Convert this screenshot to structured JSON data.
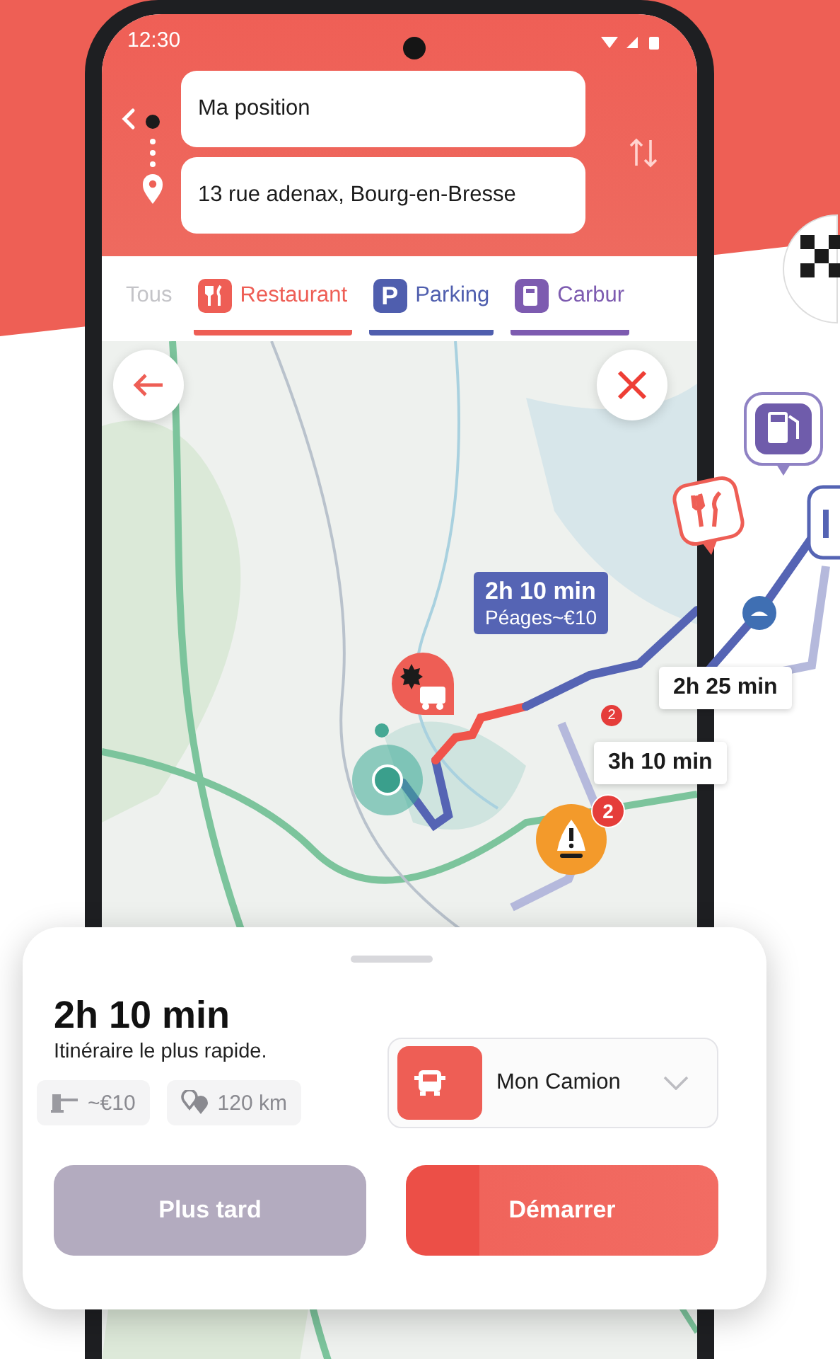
{
  "status_bar": {
    "time": "12:30"
  },
  "route": {
    "origin": {
      "value": "Ma position"
    },
    "destination": {
      "value": "13 rue adenax, Bourg-en-Bresse"
    }
  },
  "filters": [
    {
      "label": "Tous",
      "kind": "all",
      "selected": false,
      "color": "#c4c4c8"
    },
    {
      "label": "Restaurant",
      "kind": "restaurant",
      "selected": true,
      "color": "#ee5e55"
    },
    {
      "label": "Parking",
      "kind": "parking",
      "icon_text": "P",
      "selected": true,
      "color": "#4f5eae"
    },
    {
      "label": "Carbur",
      "kind": "fuel",
      "selected": true,
      "color": "#7d5bb0"
    }
  ],
  "map": {
    "route_label": {
      "duration": "2h 10 min",
      "tolls": "Péages~€10"
    },
    "incident_count": "2",
    "small_badge": "2",
    "alternatives": [
      {
        "duration": "2h 25 min"
      },
      {
        "duration": "3h 10 min"
      }
    ]
  },
  "summary": {
    "duration": "2h 10 min",
    "description": "Itinéraire le plus rapide.",
    "toll": "~€10",
    "distance": "120 km",
    "vehicle": "Mon Camion"
  },
  "buttons": [
    {
      "label": "Plus tard",
      "kind": "secondary"
    },
    {
      "label": "Démarrer",
      "kind": "primary"
    }
  ]
}
